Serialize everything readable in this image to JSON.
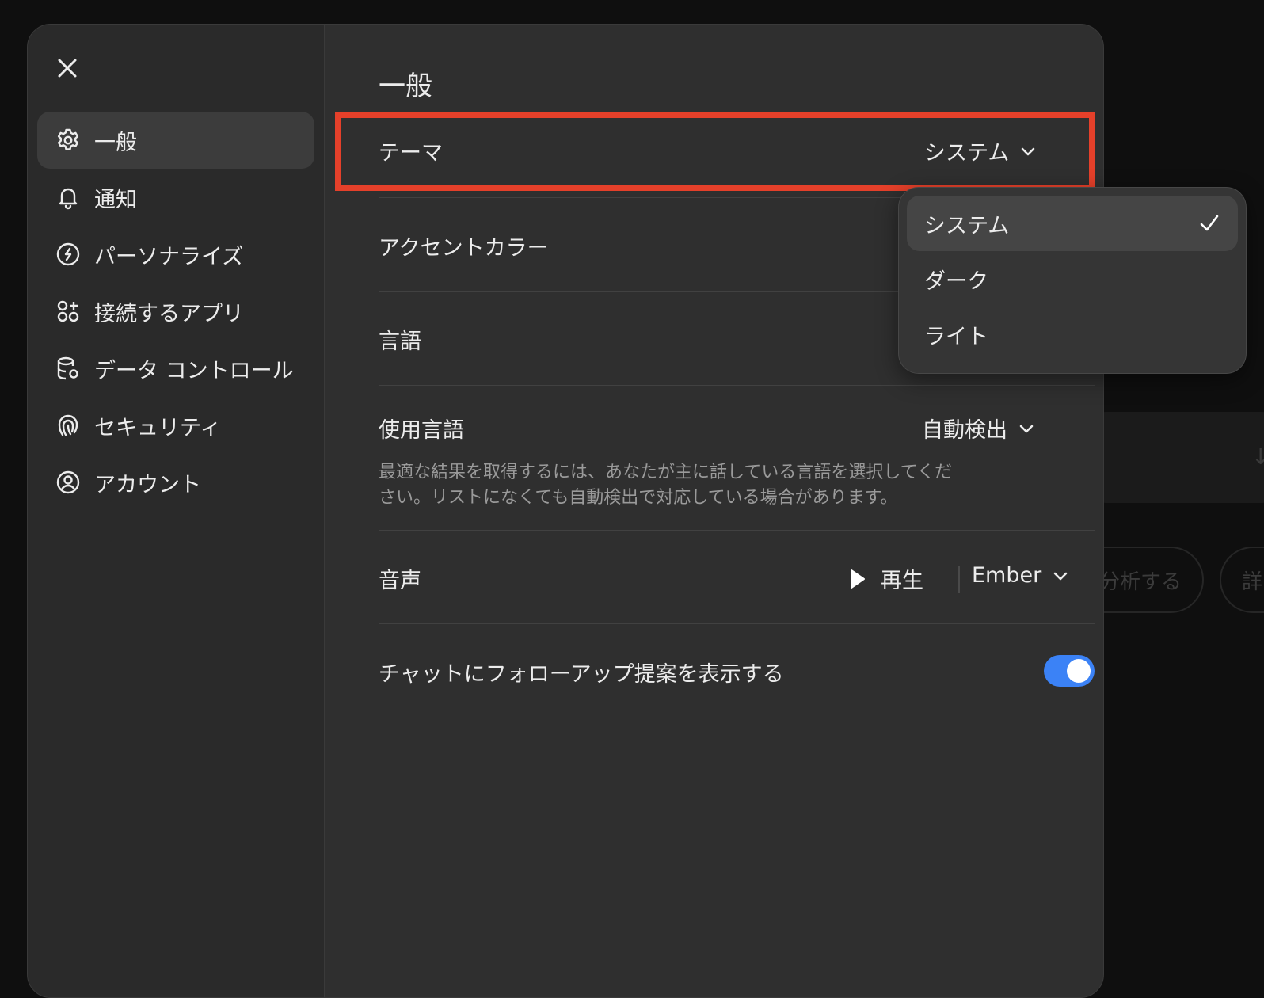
{
  "background": {
    "pills": [
      "分析する",
      "詳"
    ]
  },
  "sidebar": {
    "close_icon": "close-icon",
    "items": [
      {
        "label": "一般",
        "icon": "gear-icon",
        "active": true
      },
      {
        "label": "通知",
        "icon": "bell-icon",
        "active": false
      },
      {
        "label": "パーソナライズ",
        "icon": "clock-circle-icon",
        "active": false
      },
      {
        "label": "接続するアプリ",
        "icon": "apps-grid-icon",
        "active": false
      },
      {
        "label": "データ コントロール",
        "icon": "database-gear-icon",
        "active": false
      },
      {
        "label": "セキュリティ",
        "icon": "fingerprint-icon",
        "active": false
      },
      {
        "label": "アカウント",
        "icon": "user-circle-icon",
        "active": false
      }
    ]
  },
  "main": {
    "title": "一般",
    "theme": {
      "label": "テーマ",
      "value": "システム"
    },
    "accent": {
      "label": "アクセントカラー",
      "color": "#a9a9a9"
    },
    "language": {
      "label": "言語"
    },
    "spoken_language": {
      "label": "使用言語",
      "value": "自動検出",
      "description_line1": "最適な結果を取得するには、あなたが主に話している言語を選択してくだ",
      "description_line2": "さい。リストになくても自動検出で対応している場合があります。"
    },
    "voice": {
      "label": "音声",
      "play_label": "再生",
      "value": "Ember"
    },
    "followup": {
      "label": "チャットにフォローアップ提案を表示する",
      "enabled": true
    }
  },
  "theme_dropdown": {
    "options": [
      {
        "label": "システム",
        "selected": true
      },
      {
        "label": "ダーク",
        "selected": false
      },
      {
        "label": "ライト",
        "selected": false
      }
    ]
  },
  "colors": {
    "highlight": "#e5402a",
    "toggle_on": "#3b82f6",
    "modal_bg": "#2f2f2f",
    "sidebar_bg": "#2a2a2a"
  }
}
